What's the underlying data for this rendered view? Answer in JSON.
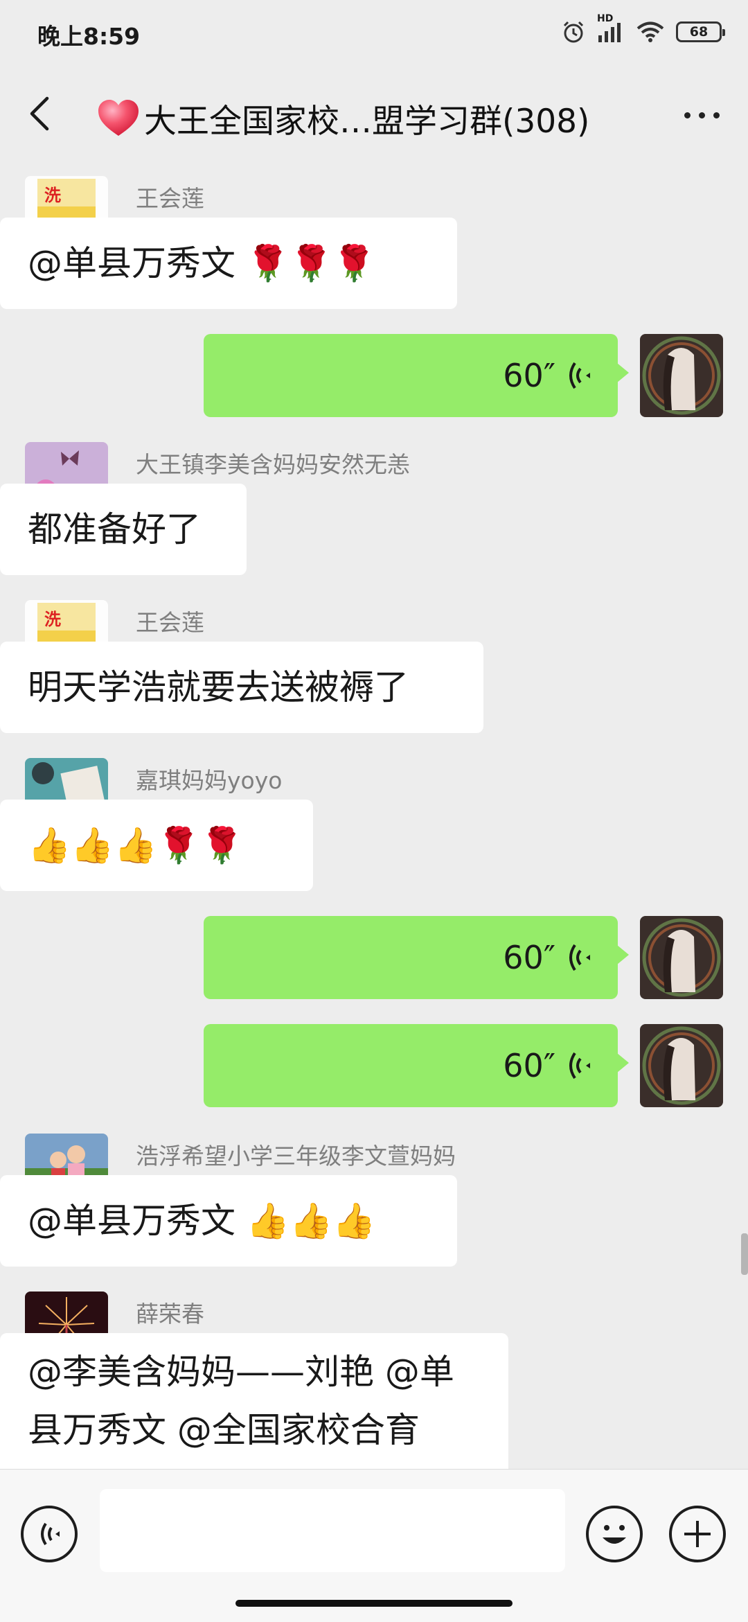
{
  "status_bar": {
    "time": "晚上8:59",
    "network_label": "HD",
    "battery": "68"
  },
  "header": {
    "title": "大王全国家校…盟学习群(308)"
  },
  "messages": [
    {
      "type": "text",
      "side": "left",
      "sender": "王会莲",
      "text": "@单县万秀文 🌹🌹🌹",
      "avatar": "rice-bag-avatar"
    },
    {
      "type": "voice",
      "side": "right",
      "duration": "60″",
      "avatar": "girl-art-avatar"
    },
    {
      "type": "text",
      "side": "left",
      "sender": "大王镇李美含妈妈安然无恙",
      "text": "都准备好了",
      "avatar": "flower-butterfly-avatar"
    },
    {
      "type": "text",
      "side": "left",
      "sender": "王会莲",
      "text": "明天学浩就要去送被褥了",
      "avatar": "rice-bag-avatar"
    },
    {
      "type": "text",
      "side": "left",
      "sender": "嘉琪妈妈yoyo",
      "text": "👍👍👍🌹🌹",
      "avatar": "desk-avatar"
    },
    {
      "type": "voice",
      "side": "right",
      "duration": "60″",
      "avatar": "girl-art-avatar"
    },
    {
      "type": "voice",
      "side": "right",
      "duration": "60″",
      "avatar": "girl-art-avatar"
    },
    {
      "type": "text",
      "side": "left",
      "sender": "浩浮希望小学三年级李文萱妈妈",
      "text": "@单县万秀文 👍👍👍",
      "avatar": "children-avatar"
    },
    {
      "type": "text",
      "side": "left",
      "sender": "薛荣春",
      "text": "@李美含妈妈——刘艳 @单县万秀文 @全国家校合育",
      "avatar": "fireworks-avatar"
    }
  ],
  "input_bar": {
    "placeholder": ""
  },
  "colors": {
    "background": "#ededed",
    "self_bubble": "#95ec69",
    "other_bubble": "#ffffff"
  }
}
